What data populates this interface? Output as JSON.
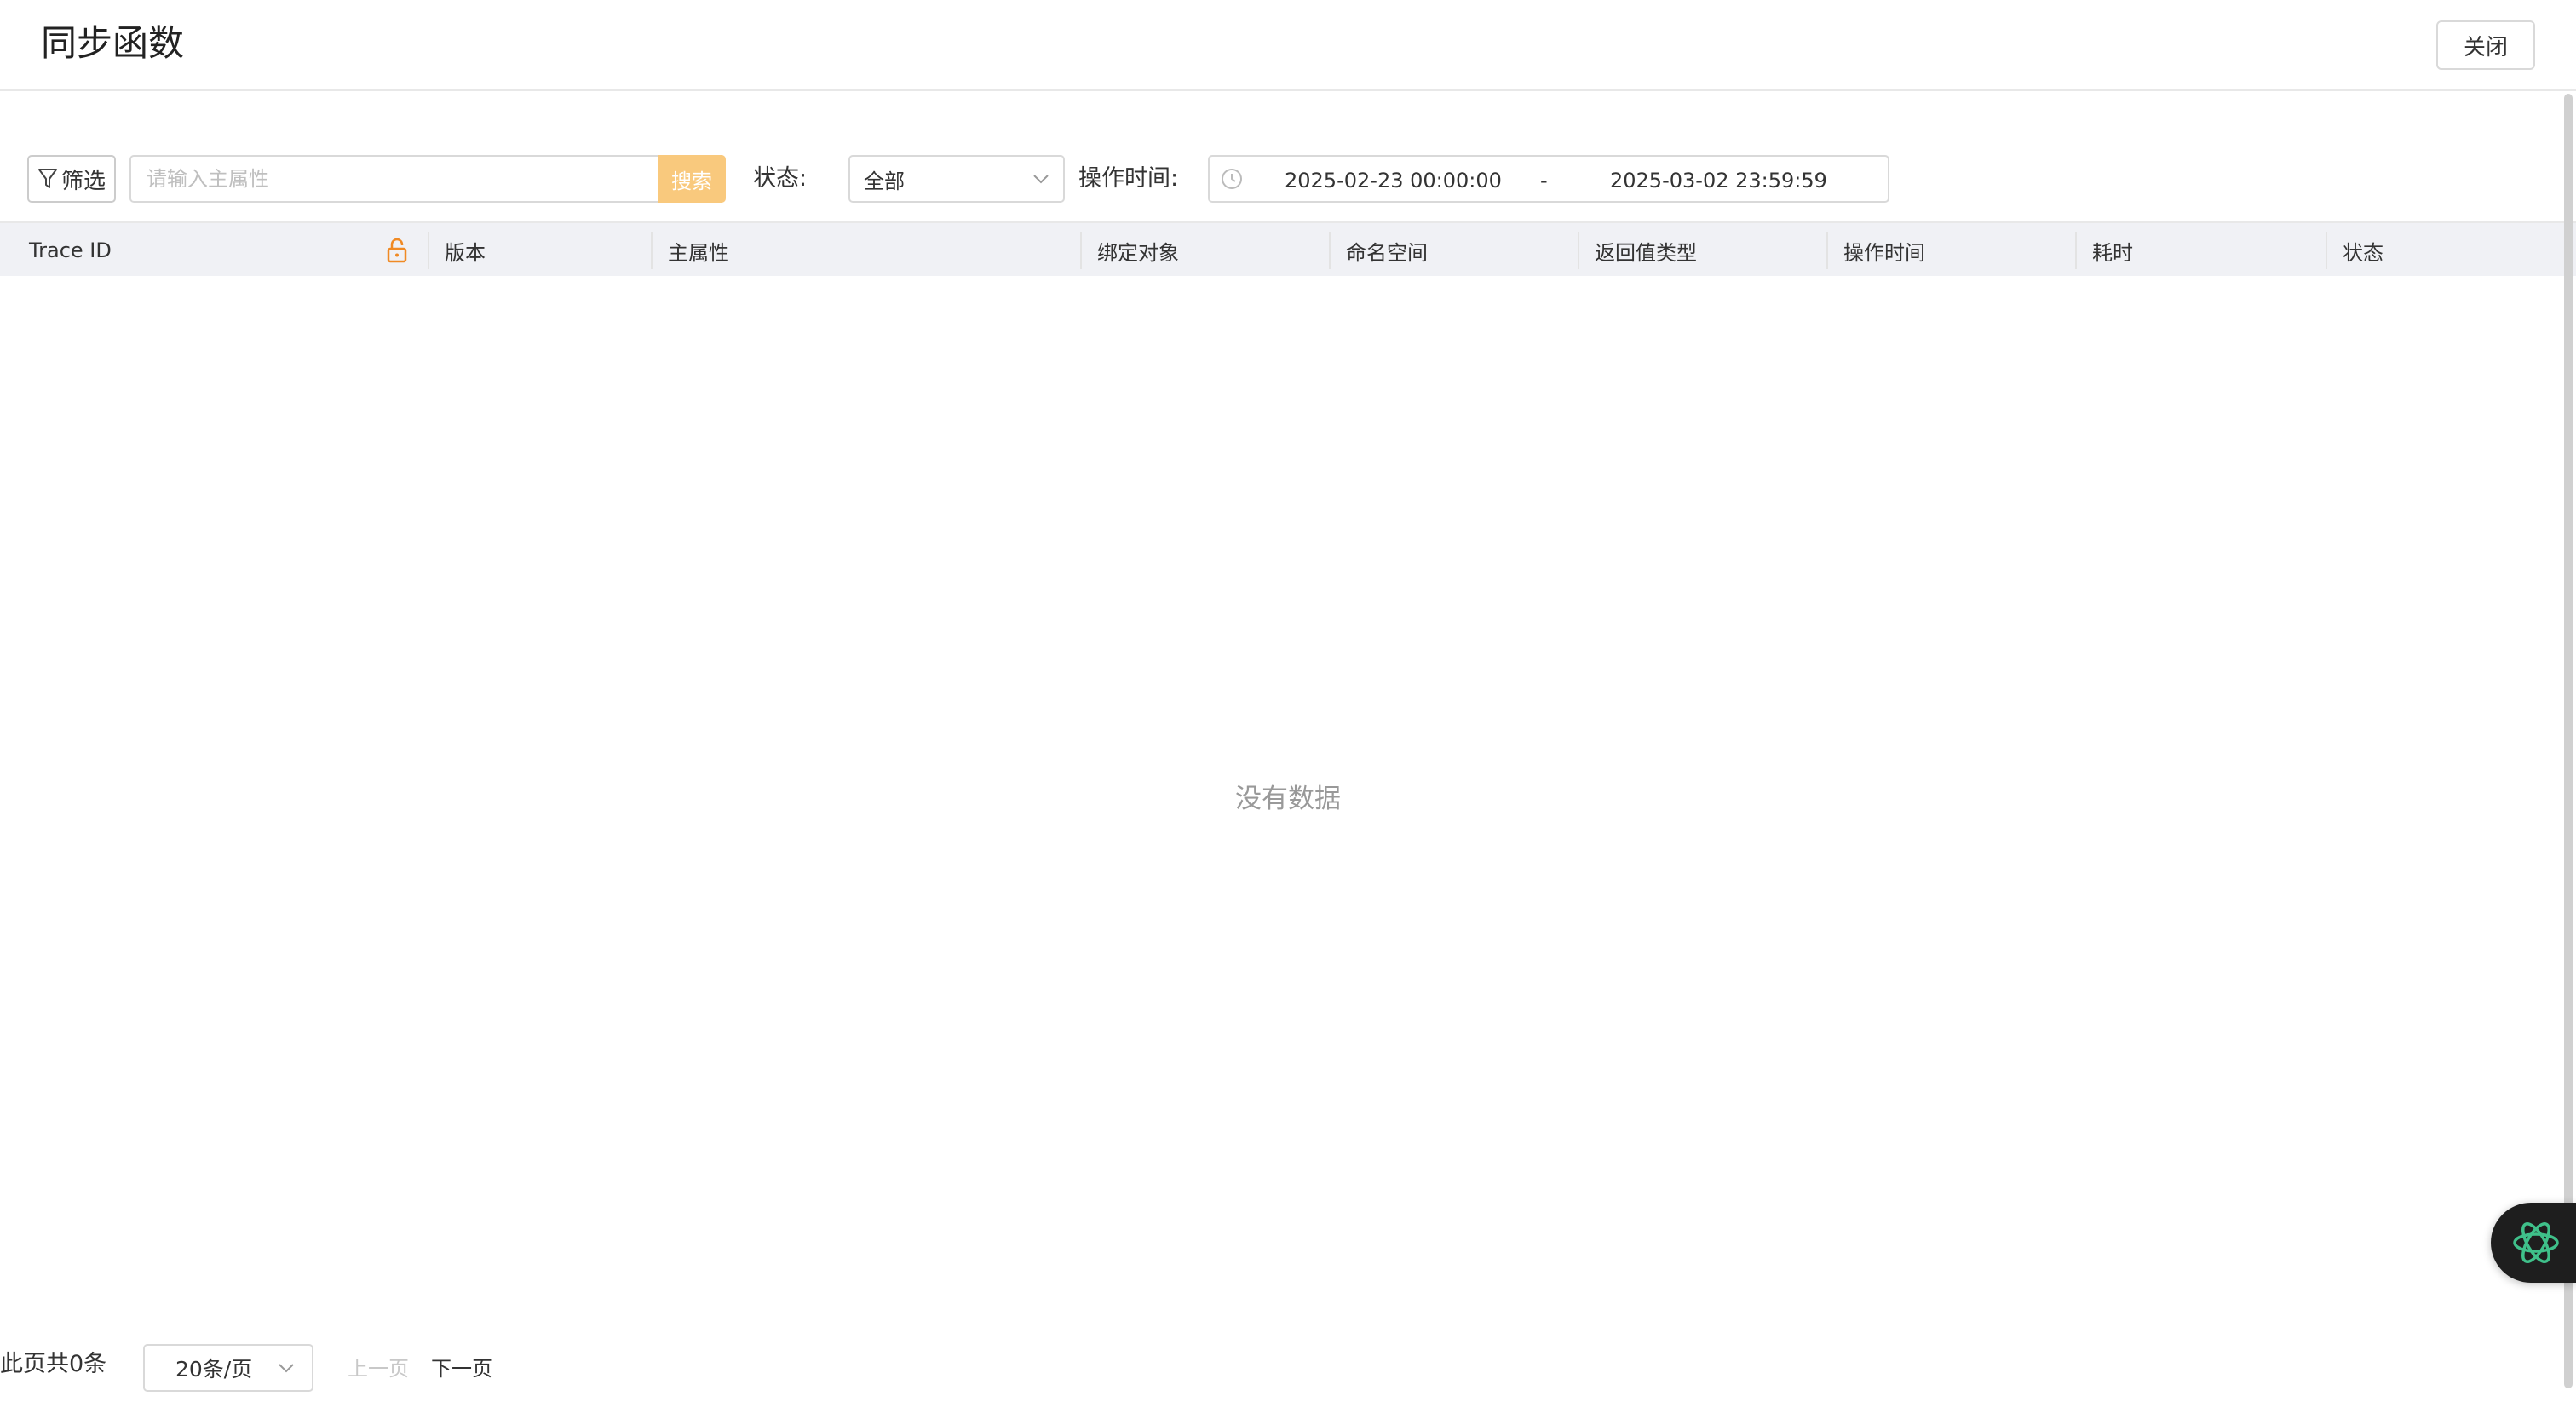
{
  "header": {
    "title": "同步函数",
    "close_label": "关闭"
  },
  "toolbar": {
    "filter_label": "筛选",
    "search_placeholder": "请输入主属性",
    "search_button_label": "搜索",
    "status_label": "状态:",
    "status_selected": "全部",
    "optime_label": "操作时间:",
    "date_start": "2025-02-23 00:00:00",
    "date_separator": "-",
    "date_end": "2025-03-02 23:59:59"
  },
  "table": {
    "columns": [
      "Trace ID",
      "版本",
      "主属性",
      "绑定对象",
      "命名空间",
      "返回值类型",
      "操作时间",
      "耗时",
      "状态"
    ],
    "empty_text": "没有数据"
  },
  "pagination": {
    "count_text": "此页共0条",
    "page_size": "20条/页",
    "prev_label": "上一页",
    "next_label": "下一页"
  },
  "colors": {
    "accent": "#f9c97d",
    "lock": "#f08a24",
    "assistant_icon": "#3fc08a",
    "header_bg": "#f0f1f5"
  },
  "icons": {
    "filter": "filter-icon",
    "chevron": "chevron-down-icon",
    "clock": "clock-icon",
    "lock": "lock-icon",
    "assistant": "assistant-logo-icon"
  }
}
